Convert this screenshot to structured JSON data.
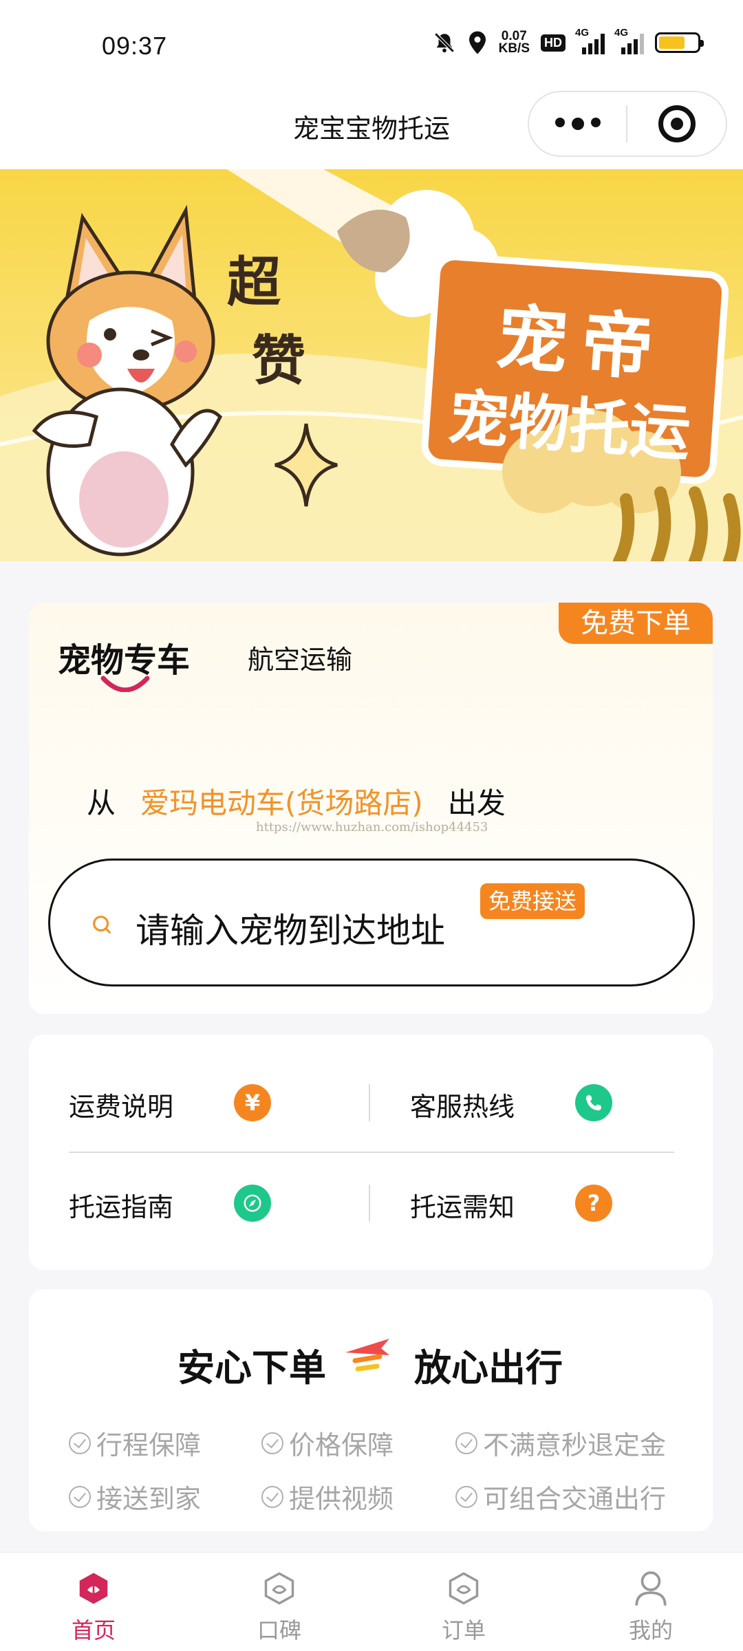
{
  "status_bar": {
    "time": "09:37",
    "net_speed_value": "0.07",
    "net_speed_unit": "KB/S",
    "hd": "HD",
    "signal1": "4G",
    "signal2": "4G",
    "battery_level": 0.68,
    "icons": [
      "mute-bell-icon",
      "location-icon",
      "hd-icon",
      "signal-icon",
      "signal-icon",
      "battery-icon"
    ]
  },
  "nav": {
    "title": "宠宝宝物托运",
    "icons": [
      "more-icon",
      "close-target-icon"
    ]
  },
  "banner": {
    "exclaim_1": "超",
    "exclaim_2": "赞",
    "brand": "宠帝",
    "slogan": "宠物托运"
  },
  "transport": {
    "badge": "免费下单",
    "tabs": [
      {
        "label": "宠物专车",
        "active": true
      },
      {
        "label": "航空运输",
        "active": false
      }
    ],
    "from_prefix": "从",
    "from_store": "爱玛电动车(货场路店)",
    "from_suffix": "出发",
    "watermark": "https://www.huzhan.com/ishop44453",
    "address_placeholder": "请输入宠物到达地址",
    "address_badge": "免费接送",
    "accent": "#f5861f"
  },
  "services": [
    {
      "label": "运费说明",
      "icon": "yuan-icon",
      "color": "#f5861f"
    },
    {
      "label": "客服热线",
      "icon": "phone-icon",
      "color": "#1ec78a"
    },
    {
      "label": "托运指南",
      "icon": "compass-icon",
      "color": "#1ec78a"
    },
    {
      "label": "托运需知",
      "icon": "question-icon",
      "color": "#f5861f"
    }
  ],
  "guarantee": {
    "title_left": "安心下单",
    "title_right": "放心出行",
    "features": [
      "行程保障",
      "价格保障",
      "不满意秒退定金",
      "接送到家",
      "提供视频",
      "可组合交通出行"
    ]
  },
  "tab_bar": {
    "items": [
      {
        "label": "首页",
        "icon": "home-icon",
        "active": true
      },
      {
        "label": "口碑",
        "icon": "reputation-icon",
        "active": false
      },
      {
        "label": "订单",
        "icon": "order-icon",
        "active": false
      },
      {
        "label": "我的",
        "icon": "profile-icon",
        "active": false
      }
    ],
    "active_color": "#d3265a"
  }
}
